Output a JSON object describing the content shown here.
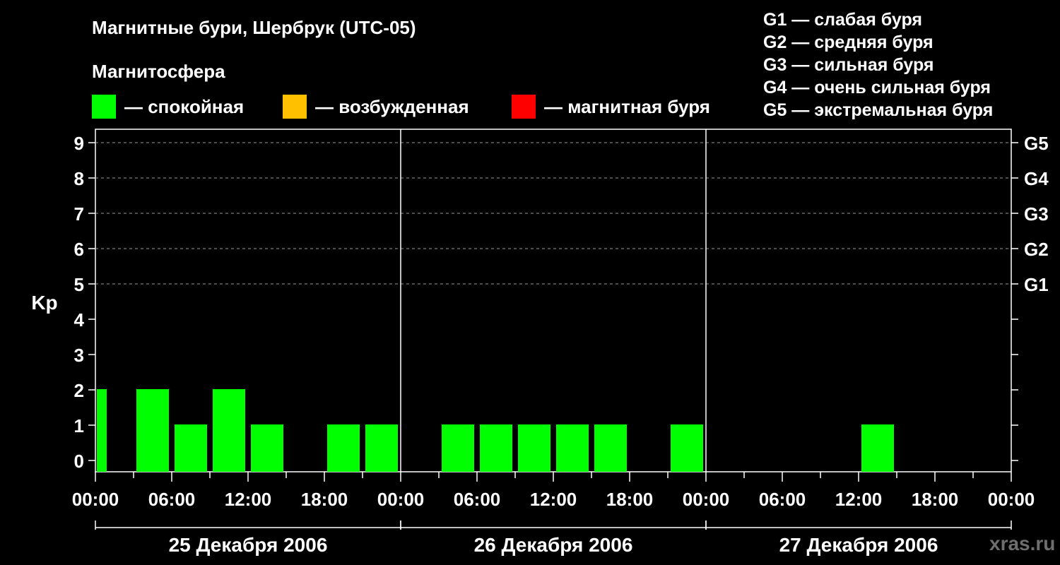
{
  "header": {
    "title": "Магнитные бури, Шербрук (UTC-05)",
    "subtitle": "Магнитосфера"
  },
  "legend": [
    {
      "label": "— спокойная",
      "color": "#00ff00"
    },
    {
      "label": "— возбужденная",
      "color": "#ffc000"
    },
    {
      "label": "— магнитная буря",
      "color": "#ff0000"
    }
  ],
  "storm_scale": [
    "G1 — слабая буря",
    "G2 — средняя буря",
    "G3 — сильная буря",
    "G4 — очень сильная буря",
    "G5 — экстремальная буря"
  ],
  "watermark": "xras.ru",
  "chart_data": {
    "type": "bar",
    "ylabel": "Kp",
    "ylim": [
      0,
      9
    ],
    "y_ticks": [
      "0",
      "1",
      "2",
      "3",
      "4",
      "5",
      "6",
      "7",
      "8",
      "9"
    ],
    "right_axis_labels": [
      {
        "kp": 5,
        "label": "G1"
      },
      {
        "kp": 6,
        "label": "G2"
      },
      {
        "kp": 7,
        "label": "G3"
      },
      {
        "kp": 8,
        "label": "G4"
      },
      {
        "kp": 9,
        "label": "G5"
      }
    ],
    "x_tick_labels": [
      "00:00",
      "06:00",
      "12:00",
      "18:00",
      "00:00",
      "06:00",
      "12:00",
      "18:00",
      "00:00",
      "06:00",
      "12:00",
      "18:00",
      "00:00"
    ],
    "days": [
      "25 Декабря 2006",
      "26 Декабря 2006",
      "27 Декабря 2006"
    ],
    "interval_hours": 3,
    "bar_color": "#00ff00",
    "series": [
      {
        "day": "25 Декабря 2006",
        "values": [
          2,
          2,
          1,
          2,
          1,
          0,
          1,
          1
        ],
        "first_interval_partial": true
      },
      {
        "day": "26 Декабря 2006",
        "values": [
          0,
          1,
          1,
          1,
          1,
          1,
          0,
          1
        ]
      },
      {
        "day": "27 Декабря 2006",
        "values": [
          0,
          0,
          0,
          0,
          1,
          0,
          0,
          0
        ]
      }
    ],
    "grid": "dashed at Kp 5-9"
  }
}
